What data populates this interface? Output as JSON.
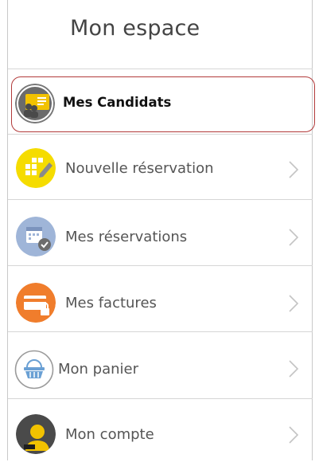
{
  "header": {
    "title": "Mon espace"
  },
  "menu": {
    "items": [
      {
        "label": "Mes Candidats",
        "icon": "candidates-card-icon",
        "active": true
      },
      {
        "label": "Nouvelle réservation",
        "icon": "new-booking-icon"
      },
      {
        "label": "Mes réservations",
        "icon": "calendar-check-icon"
      },
      {
        "label": "Mes factures",
        "icon": "invoice-card-lock-icon"
      },
      {
        "label": "Mon panier",
        "icon": "basket-icon"
      },
      {
        "label": "Mon compte",
        "icon": "user-account-icon"
      }
    ]
  },
  "colors": {
    "active_border": "#b23a3a",
    "candidates_bg": "#f2c200",
    "new_booking_bg": "#f5dc00",
    "reservations_bg": "#9fb5d8",
    "invoices_bg": "#f07d2c",
    "basket_bg": "#ffffff",
    "account_bg": "#4a4a4a"
  }
}
